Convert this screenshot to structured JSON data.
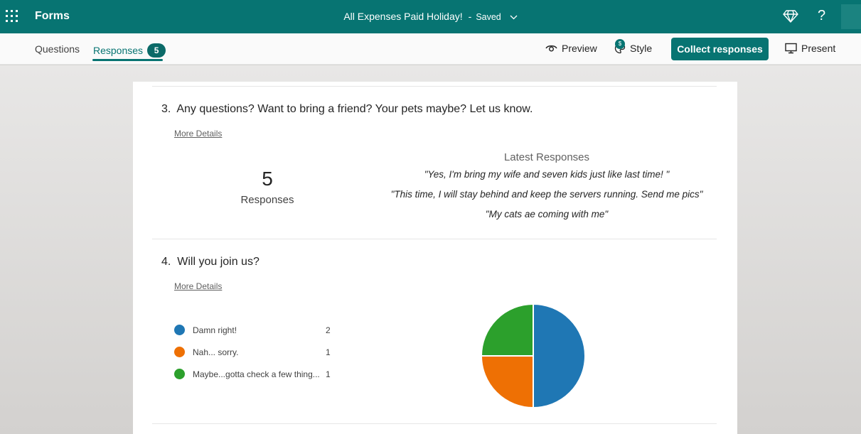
{
  "app": {
    "name": "Forms"
  },
  "document": {
    "title": "All Expenses Paid Holiday!",
    "separator": "-",
    "status": "Saved"
  },
  "tabs": [
    {
      "label": "Questions"
    },
    {
      "label": "Responses",
      "count": "5"
    }
  ],
  "actions": {
    "preview": "Preview",
    "style": "Style",
    "style_badge": "$",
    "collect": "Collect responses",
    "present": "Present"
  },
  "topbar": {
    "help": "?"
  },
  "questions": [
    {
      "number": "3.",
      "title": "Any questions? Want to bring a friend? Your pets maybe? Let us know.",
      "more_details": "More Details",
      "response_count": "5",
      "response_label": "Responses",
      "latest_title": "Latest Responses",
      "latest": [
        "\"Yes, I'm bring my wife and seven kids just like last time! \"",
        "\"This time, I will stay behind and keep the servers running. Send me pics\"",
        "\"My cats ae coming with me\""
      ]
    },
    {
      "number": "4.",
      "title": "Will you join us?",
      "more_details": "More Details",
      "options": [
        {
          "label": "Damn right!",
          "count": "2",
          "color": "#1f77b4"
        },
        {
          "label": "Nah... sorry.",
          "count": "1",
          "color": "#ee7004"
        },
        {
          "label": "Maybe...gotta check a few thing...",
          "count": "1",
          "color": "#2ca02c"
        }
      ]
    }
  ],
  "chart_data": {
    "type": "pie",
    "categories": [
      "Damn right!",
      "Nah... sorry.",
      "Maybe...gotta check a few thing..."
    ],
    "values": [
      2,
      1,
      1
    ],
    "colors": [
      "#1f77b4",
      "#ee7004",
      "#2ca02c"
    ]
  },
  "colors": {
    "brand": "#077472"
  }
}
